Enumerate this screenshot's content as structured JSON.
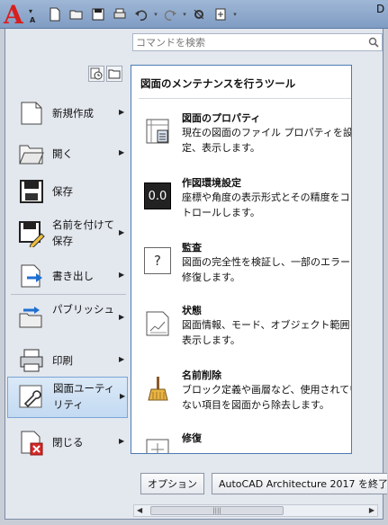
{
  "title": {
    "text": "D"
  },
  "qat": {
    "dropdown_glyph": "▾",
    "mini_label": "A"
  },
  "search": {
    "placeholder": "コマンドを検索"
  },
  "left_menu": {
    "items": [
      {
        "id": "new",
        "label": "新規作成",
        "icon": "new-file-icon",
        "has_submenu": true
      },
      {
        "id": "open",
        "label": "開く",
        "icon": "folder-open-icon",
        "has_submenu": true
      },
      {
        "id": "save",
        "label": "保存",
        "icon": "save-icon",
        "has_submenu": false
      },
      {
        "id": "saveas",
        "label": "名前を付けて保存",
        "icon": "save-as-icon",
        "has_submenu": true
      },
      {
        "id": "export",
        "label": "書き出し",
        "icon": "export-icon",
        "has_submenu": true
      },
      {
        "id": "publish",
        "label": "パブリッシュ",
        "icon": "publish-icon",
        "has_submenu": true
      },
      {
        "id": "print",
        "label": "印刷",
        "icon": "printer-icon",
        "has_submenu": true
      },
      {
        "id": "utilities",
        "label": "図面ユーティリティ",
        "icon": "wrench-icon",
        "has_submenu": true,
        "selected": true
      },
      {
        "id": "close",
        "label": "閉じる",
        "icon": "close-drawing-icon",
        "has_submenu": true
      }
    ],
    "arrow": "▶"
  },
  "panel": {
    "title": "図面のメンテナンスを行うツール",
    "tools": [
      {
        "name": "図面のプロパティ",
        "desc": "現在の図面のファイル プロパティを設定、表示します。",
        "icon": "drawing-properties-icon"
      },
      {
        "name": "作図環境設定",
        "desc": "座標や角度の表示形式とその精度をコントロールします。",
        "icon": "units-icon",
        "icon_text": "0.0"
      },
      {
        "name": "監査",
        "desc": "図面の完全性を検証し、一部のエラーを修復します。",
        "icon": "audit-icon",
        "icon_text": "?"
      },
      {
        "name": "状態",
        "desc": "図面情報、モード、オブジェクト範囲を表示します。",
        "icon": "status-icon"
      },
      {
        "name": "名前削除",
        "desc": "ブロック定義や画層など、使用されていない項目を図面から除去します。",
        "icon": "purge-broom-icon"
      },
      {
        "name": "修復",
        "desc": "",
        "icon": "recover-icon"
      }
    ],
    "scroll_glyph": "▼"
  },
  "bottom": {
    "options_label": "オプション",
    "exit_label": "AutoCAD Architecture 2017 を終了"
  },
  "hscroll": {
    "left": "◀",
    "right": "▶",
    "grip": "||||"
  },
  "colors": {
    "accent": "#4c7bb3",
    "logo_red": "#d71f1f"
  }
}
